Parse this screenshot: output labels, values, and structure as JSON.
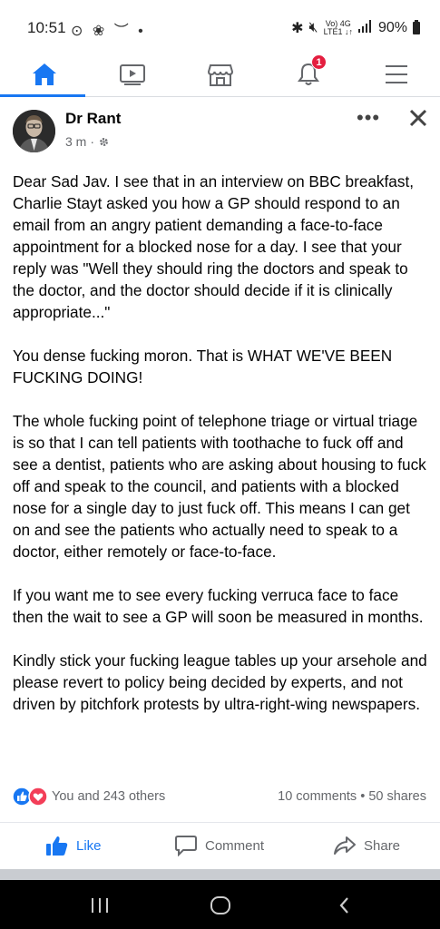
{
  "status_bar": {
    "time": "10:51",
    "left_icons": "⊙ ❀ ︶ •",
    "network": "Vo) 4G",
    "network_sub": "LTE1 ↓↑",
    "battery": "90%"
  },
  "nav": {
    "items": [
      "home-icon",
      "watch-icon",
      "marketplace-icon",
      "notifications-icon",
      "menu-icon"
    ],
    "notification_count": "1",
    "accent": "#1877f2"
  },
  "post": {
    "author": "Dr Rant",
    "time": "3 m",
    "separator": "·",
    "more": "•••",
    "paragraphs": [
      "Dear Sad Jav. I see that in an interview on BBC breakfast, Charlie Stayt asked you how a GP should respond to an email from an angry patient demanding a face-to-face appointment for a blocked nose for a day. I see that your reply was \"Well they should ring the doctors and speak to the doctor, and the doctor should decide if it is clinically appropriate...\"",
      "You dense fucking moron. That is WHAT WE'VE BEEN FUCKING DOING!",
      "The whole fucking point of telephone triage or virtual triage is so that I can tell patients with toothache to fuck off and see a dentist, patients who are asking about housing to fuck off and speak to the council, and patients with a blocked nose for a single day to just fuck off. This means I can get on and see the patients who actually need to speak to a doctor, either remotely or face-to-face.",
      "If you want me to see every fucking verruca face to face then the wait to see a GP will soon be measured in months.",
      "Kindly stick your fucking league tables up your arsehole and please revert to policy being decided by experts, and not driven by pitchfork protests by ultra-right-wing newspapers."
    ],
    "reactions_text": "You and 243 others",
    "comments": "10 comments",
    "shares": "50 shares",
    "dot": "•"
  },
  "actions": {
    "like": "Like",
    "comment": "Comment",
    "share": "Share"
  }
}
